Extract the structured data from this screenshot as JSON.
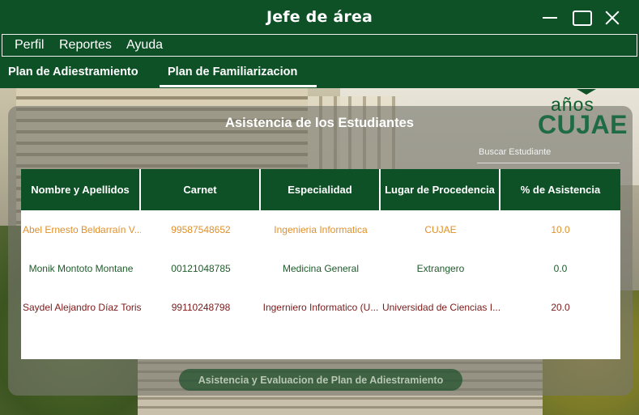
{
  "window": {
    "title": "Jefe de área"
  },
  "menu": {
    "items": [
      "Perfil",
      "Reportes",
      "Ayuda"
    ]
  },
  "tabs": [
    {
      "label": "Plan de Adiestramiento",
      "active": false
    },
    {
      "label": "Plan de Familiarizacion",
      "active": true
    }
  ],
  "panel": {
    "title": "Asistencia de los Estudiantes"
  },
  "logo": {
    "top_text": "años",
    "brand": "CUJAE"
  },
  "search": {
    "placeholder": "Buscar Estudiante"
  },
  "table": {
    "columns": [
      "Nombre y Apellidos",
      "Carnet",
      "Especialidad",
      "Lugar de Procedencia",
      "% de Asistencia"
    ],
    "rows": [
      {
        "name": "Abel Ernesto Beldarraín V...",
        "carnet": "99587548652",
        "especialidad": "Ingenieria Informatica",
        "lugar": "CUJAE",
        "asistencia": "10.0",
        "color": "#e0902a"
      },
      {
        "name": "Monik Montoto Montane",
        "carnet": "00121048785",
        "especialidad": "Medicina General",
        "lugar": "Extrangero",
        "asistencia": "0.0",
        "color": "#1e5b2a"
      },
      {
        "name": "Saydel Alejandro Díaz Toris",
        "carnet": "99110248798",
        "especialidad": "Ingerniero Informatico (U...",
        "lugar": "Universidad de Ciencias I...",
        "asistencia": "20.0",
        "color": "#7a1a1a"
      }
    ]
  },
  "actions": {
    "primary_label": "Asistencia y Evaluacion de Plan de Adiestramiento"
  },
  "colors": {
    "primary": "#0e5127",
    "accent_row1": "#e0902a",
    "accent_row2": "#1e5b2a",
    "accent_row3": "#7a1a1a"
  }
}
